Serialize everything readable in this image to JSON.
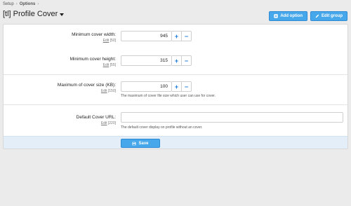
{
  "breadcrumb": {
    "items": [
      "Setup",
      "Options"
    ],
    "separator": "›"
  },
  "header": {
    "title": "[tl] Profile Cover",
    "buttons": {
      "add_option": "Add option",
      "edit_group": "Edit group"
    }
  },
  "options": [
    {
      "label": "Minimum cover width:",
      "edit": "Edit",
      "order": "[50]",
      "value": "945",
      "hint": ""
    },
    {
      "label": "Minimum cover height:",
      "edit": "Edit",
      "order": "[55]",
      "value": "315",
      "hint": ""
    },
    {
      "label": "Maximum of cover size (KB):",
      "edit": "Edit",
      "order": "[150]",
      "value": "100",
      "hint": "The maximum of cover file size which user can use for cover."
    },
    {
      "label": "Default Cover URL:",
      "edit": "Edit",
      "order": "[220]",
      "value": "",
      "hint": "The default cover display on profile without an cover."
    }
  ],
  "stepper": {
    "plus": "+",
    "minus": "−"
  },
  "footer": {
    "save_label": "Save"
  },
  "colors": {
    "accent": "#47a7eb",
    "footer_bg": "#e3eef9",
    "page_bg": "#ebebeb"
  },
  "icons": {
    "add_option": "plus-square-icon",
    "edit_group": "pencil-icon",
    "save": "floppy-disk-icon",
    "title_menu": "caret-down-icon"
  }
}
